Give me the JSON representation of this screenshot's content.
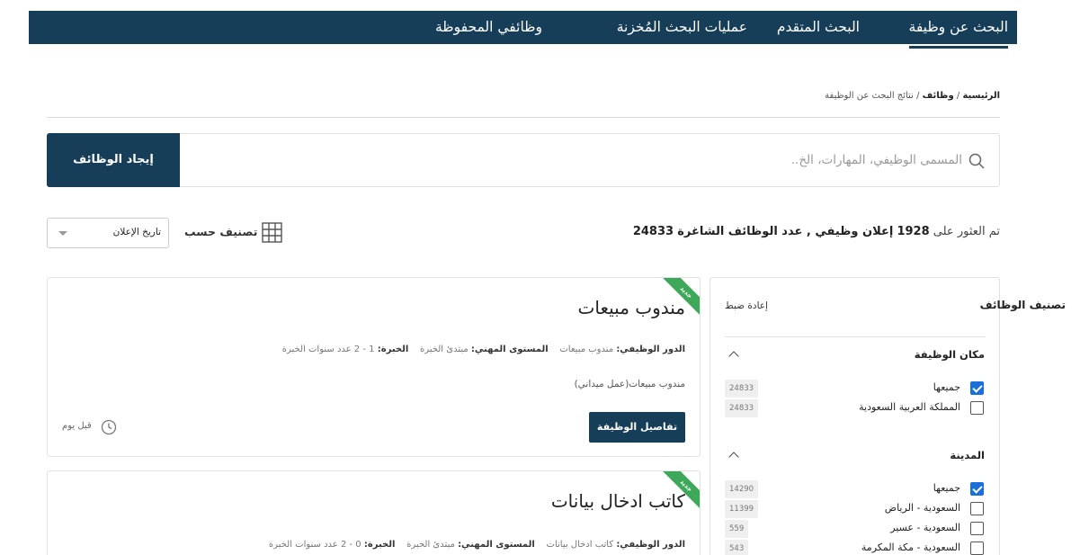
{
  "nav": {
    "search_jobs": "البحث عن وظيفة",
    "advanced_search": "البحث المتقدم",
    "saved_searches": "عمليات البحث المُخزنة",
    "saved_jobs": "وظائفي المحفوظة"
  },
  "breadcrumb": {
    "home": "الرئيسية",
    "jobs": "وظائف",
    "current": "نتائج البحث عن الوظيفة",
    "sep": "/"
  },
  "search": {
    "placeholder": "المسمى الوظيفي، المهارات، الخ..",
    "button": "إيجاد الوظائف"
  },
  "results": {
    "prefix": "تم العثور على",
    "count": "1928",
    "middle": "إعلان وظيفي , عدد الوظائف الشاغرة",
    "vacancies": "24833"
  },
  "sort": {
    "label": "تصنيف حسب",
    "selected": "تاريخ الإعلان"
  },
  "filters": {
    "title": "تصنيف الوظائف",
    "reset": "إعادة ضبط",
    "location": {
      "title": "مكان الوظيفة",
      "items": [
        {
          "label": "جميعها",
          "count": "24833",
          "checked": true
        },
        {
          "label": "المملكة العربية السعودية",
          "count": "24833",
          "checked": false
        }
      ]
    },
    "city": {
      "title": "المدينة",
      "items": [
        {
          "label": "جميعها",
          "count": "14290",
          "checked": true
        },
        {
          "label": "السعودية - الرياض",
          "count": "11399",
          "checked": false
        },
        {
          "label": "السعودية - عسير",
          "count": "559",
          "checked": false
        },
        {
          "label": "السعودية - مكة المكرمة",
          "count": "543",
          "checked": false
        }
      ]
    }
  },
  "jobs": [
    {
      "badge": "جديد",
      "title": "مندوب مبيعات",
      "role_label": "الدور الوظيفي:",
      "role": "مندوب مبيعات",
      "level_label": "المستوى المهني:",
      "level": "مبتدئ الخبرة",
      "exp_label": "الخبرة:",
      "exp": "1 - 2 عدد سنوات الخبرة",
      "description": "مندوب مبيعات(عمل ميداني)",
      "details_button": "تفاصيل الوظيفة",
      "posted": "قبل يوم"
    },
    {
      "badge": "جديد",
      "title": "كاتب ادخال بيانات",
      "role_label": "الدور الوظيفي:",
      "role": "كاتب ادخال بيانات",
      "level_label": "المستوى المهني:",
      "level": "مبتدئ الخبرة",
      "exp_label": "الخبرة:",
      "exp": "0 - 2 عدد سنوات الخبرة"
    }
  ]
}
